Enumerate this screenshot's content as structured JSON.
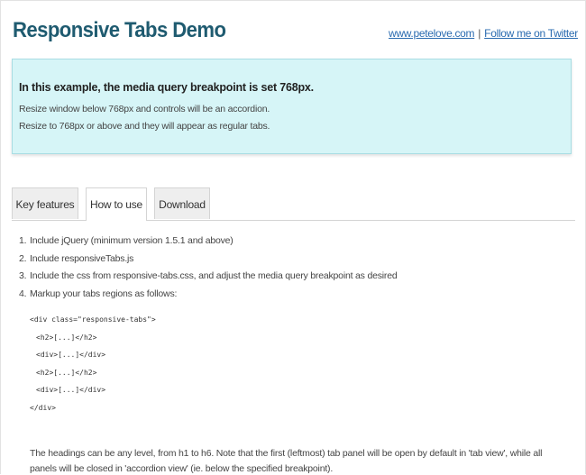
{
  "header": {
    "title": "Responsive Tabs Demo",
    "site_link": "www.petelove.com",
    "separator": "|",
    "twitter_link": "Follow me on Twitter"
  },
  "notice": {
    "heading": "In this example, the media query breakpoint is set 768px.",
    "line1": "Resize window below 768px and controls will be an accordion.",
    "line2": "Resize to 768px or above and they will appear as regular tabs."
  },
  "tabs": [
    {
      "label": "Key features",
      "active": false
    },
    {
      "label": "How to use",
      "active": true
    },
    {
      "label": "Download",
      "active": false
    }
  ],
  "panel": {
    "steps": [
      {
        "num": "1.",
        "text": "Include jQuery (minimum version 1.5.1 and above)"
      },
      {
        "num": "2.",
        "text": "Include responsiveTabs.js"
      },
      {
        "num": "3.",
        "text": "Include the css from responsive-tabs.css, and adjust the media query breakpoint as desired"
      },
      {
        "num": "4.",
        "text": "Markup your tabs regions as follows:"
      }
    ],
    "code": [
      "<div class=\"responsive-tabs\">",
      "<h2>[...]</h2>",
      "<div>[...]</div>",
      "<h2>[...]</h2>",
      "<div>[...]</div>",
      "</div>"
    ],
    "note": "The headings can be any level, from h1 to h6. Note that the first (leftmost) tab panel will be open by default in 'tab view', while all panels will be closed in 'accordion view' (ie. below the specified breakpoint)."
  },
  "colors": {
    "title": "#1f5b70",
    "link": "#2a6bb0",
    "notice_bg": "#d6f5f7",
    "notice_border": "#a9dde3",
    "tab_bg": "#eeeeee",
    "tab_border": "#d4d4d4"
  }
}
